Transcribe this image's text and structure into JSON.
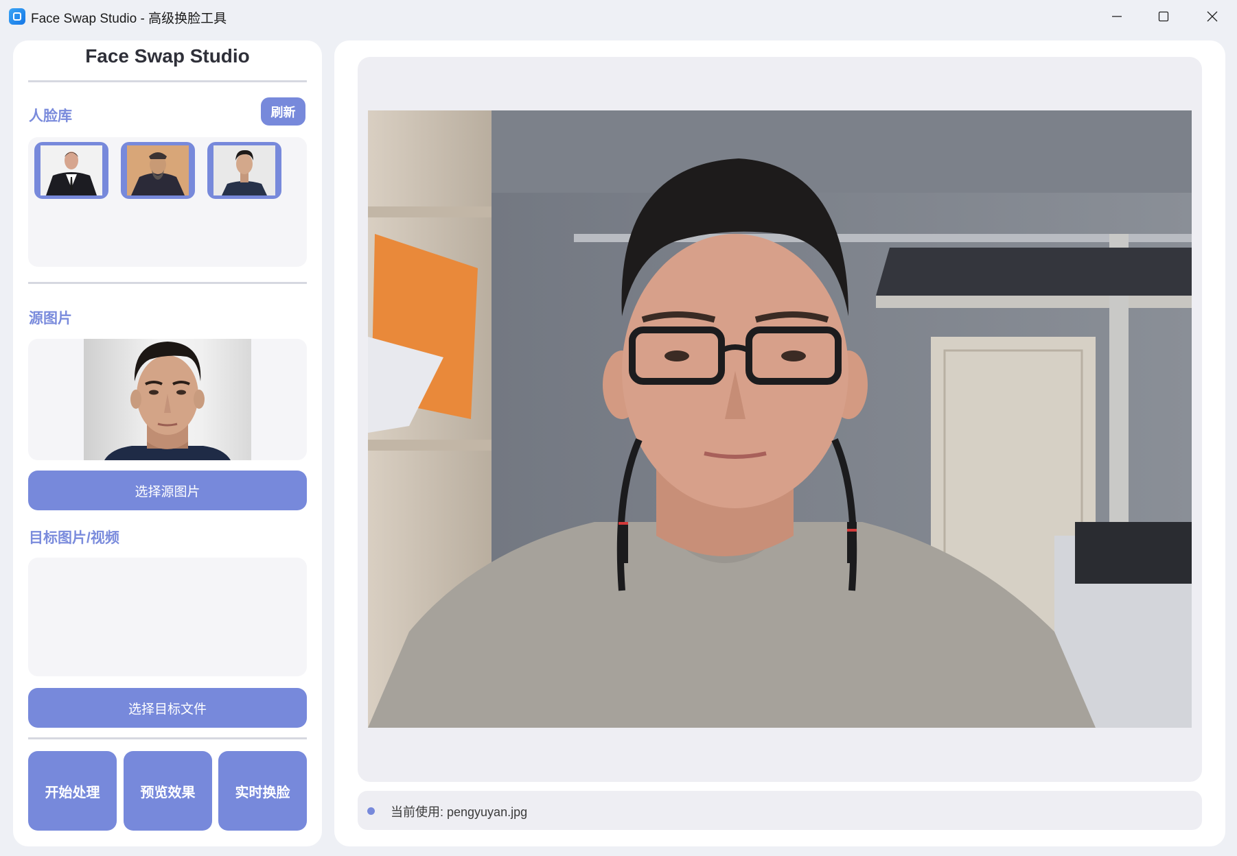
{
  "window": {
    "title": "Face Swap Studio - 高级换脸工具",
    "controls": [
      "minimize-icon",
      "maximize-icon",
      "close-icon"
    ]
  },
  "sidebar": {
    "title": "Face Swap Studio",
    "face_library": {
      "label": "人脸库",
      "refresh_label": "刷新",
      "thumbnails": [
        "elon-musk-portrait",
        "ancient-scholar-painting",
        "pengyuyan-portrait"
      ]
    },
    "source": {
      "label": "源图片",
      "select_label": "选择源图片"
    },
    "target": {
      "label": "目标图片/视频",
      "select_label": "选择目标文件"
    },
    "actions": {
      "start_label": "开始处理",
      "preview_label": "预览效果",
      "realtime_label": "实时换脸"
    }
  },
  "main": {
    "preview_image": "webcam-feed-person-in-dorm",
    "status": {
      "text": "当前使用: pengyuyan.jpg"
    }
  },
  "colors": {
    "accent": "#7789db",
    "section_label": "#7a8bdc",
    "background": "#eef0f5",
    "panel": "#ffffff"
  }
}
